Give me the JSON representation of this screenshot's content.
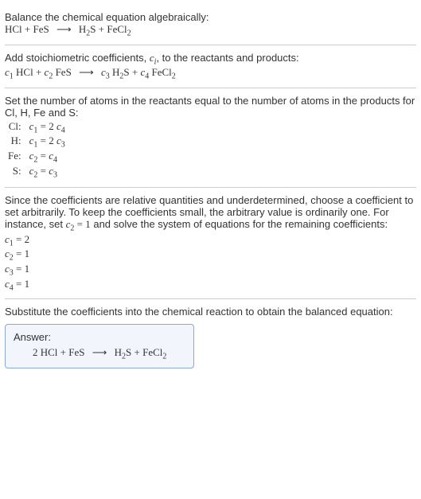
{
  "sec1": {
    "intro": "Balance the chemical equation algebraically:",
    "r1": "HCl",
    "plus": "+",
    "r2": "FeS",
    "arrow": "⟶",
    "p1a": "H",
    "p1b": "2",
    "p1c": "S",
    "p2a": "FeCl",
    "p2b": "2"
  },
  "sec2": {
    "intro_a": "Add stoichiometric coefficients, ",
    "intro_c": "c",
    "intro_i": "i",
    "intro_b": ", to the reactants and products:",
    "c1": "c",
    "n1": "1",
    "r1": " HCl",
    "c2": "c",
    "n2": "2",
    "r2": " FeS",
    "c3": "c",
    "n3": "3",
    "p1a": " H",
    "p1b": "2",
    "p1c": "S",
    "c4": "c",
    "n4": "4",
    "p2a": " FeCl",
    "p2b": "2"
  },
  "sec3": {
    "intro": "Set the number of atoms in the reactants equal to the number of atoms in the products for Cl, H, Fe and S:",
    "rows": [
      {
        "lbl": "Cl:",
        "lhs_c": "c",
        "lhs_n": "1",
        "eq": " = 2 ",
        "rhs_c": "c",
        "rhs_n": "4"
      },
      {
        "lbl": "H:",
        "lhs_c": "c",
        "lhs_n": "1",
        "eq": " = 2 ",
        "rhs_c": "c",
        "rhs_n": "3"
      },
      {
        "lbl": "Fe:",
        "lhs_c": "c",
        "lhs_n": "2",
        "eq": " = ",
        "rhs_c": "c",
        "rhs_n": "4"
      },
      {
        "lbl": "S:",
        "lhs_c": "c",
        "lhs_n": "2",
        "eq": " = ",
        "rhs_c": "c",
        "rhs_n": "3"
      }
    ]
  },
  "sec4": {
    "intro_a": "Since the coefficients are relative quantities and underdetermined, choose a coefficient to set arbitrarily. To keep the coefficients small, the arbitrary value is ordinarily one. For instance, set ",
    "set_c": "c",
    "set_n": "2",
    "set_v": " = 1",
    "intro_b": " and solve the system of equations for the remaining coefficients:",
    "lines": [
      {
        "c": "c",
        "n": "1",
        "v": " = 2"
      },
      {
        "c": "c",
        "n": "2",
        "v": " = 1"
      },
      {
        "c": "c",
        "n": "3",
        "v": " = 1"
      },
      {
        "c": "c",
        "n": "4",
        "v": " = 1"
      }
    ]
  },
  "sec5": {
    "intro": "Substitute the coefficients into the chemical reaction to obtain the balanced equation:",
    "answer_label": "Answer:",
    "coef": "2 ",
    "r1": "HCl",
    "plus": "+",
    "r2": "FeS",
    "arrow": "⟶",
    "p1a": "H",
    "p1b": "2",
    "p1c": "S",
    "p2a": "FeCl",
    "p2b": "2"
  }
}
